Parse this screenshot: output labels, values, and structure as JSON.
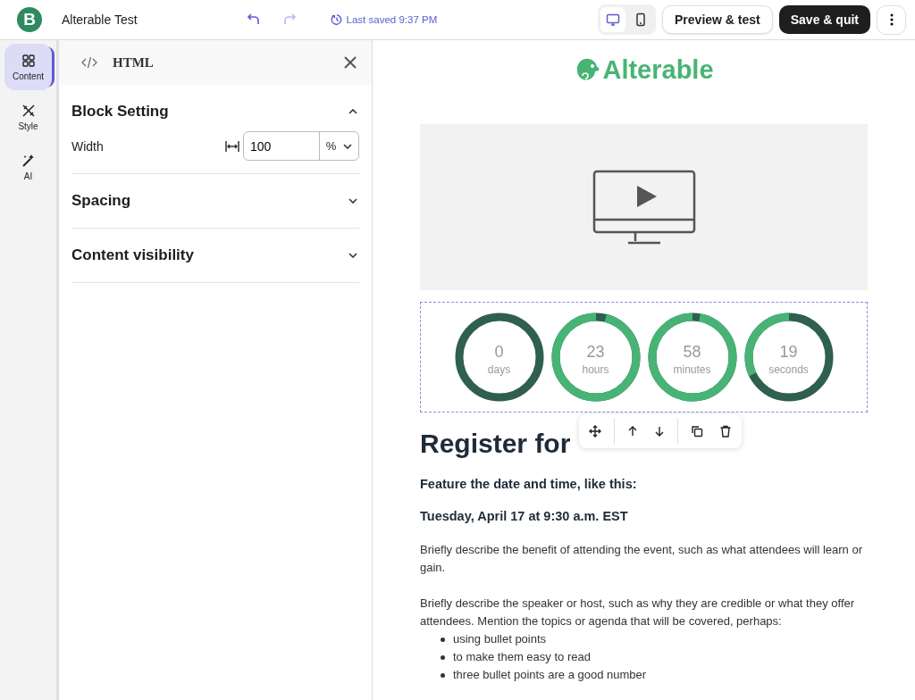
{
  "topbar": {
    "logo": "B",
    "title": "Alterable Test",
    "last_saved": "Last saved 9:37 PM",
    "devices": [
      {
        "kind": "desktop",
        "selected": true
      },
      {
        "kind": "mobile",
        "selected": false
      }
    ],
    "preview_button": "Preview & test",
    "save_button": "Save & quit"
  },
  "rail": [
    {
      "kind": "content",
      "label": "Content",
      "selected": true
    },
    {
      "kind": "style",
      "label": "Style",
      "selected": false
    },
    {
      "kind": "ai",
      "label": "AI",
      "selected": false
    }
  ],
  "panel": {
    "title": "HTML",
    "sections": [
      {
        "title": "Block Setting",
        "expanded": true,
        "fields": [
          {
            "label": "Width",
            "value": "100",
            "unit": "%"
          }
        ]
      },
      {
        "title": "Spacing",
        "expanded": false
      },
      {
        "title": "Content visibility",
        "expanded": false
      }
    ]
  },
  "email": {
    "brand": "Alterable",
    "countdown": [
      {
        "value": "0",
        "unit": "days",
        "level": 0
      },
      {
        "value": "23",
        "unit": "hours",
        "level": 0.96
      },
      {
        "value": "58",
        "unit": "minutes",
        "level": 0.97
      },
      {
        "value": "19",
        "unit": "seconds",
        "level": 0.32
      }
    ],
    "heading": "Register for",
    "subheads": [
      "Feature the date and time, like this:",
      "Tuesday, April 17 at 9:30 a.m. EST"
    ],
    "paragraphs": [
      "Briefly describe the benefit of attending the event, such as what attendees will learn or gain.",
      "Briefly describe the speaker or host, such as why they are credible or what they offer attendees. Mention the topics or agenda that will be covered, perhaps:"
    ],
    "bullets": [
      "using bullet points",
      "to make them easy to read",
      "three bullet points are a good number"
    ]
  }
}
